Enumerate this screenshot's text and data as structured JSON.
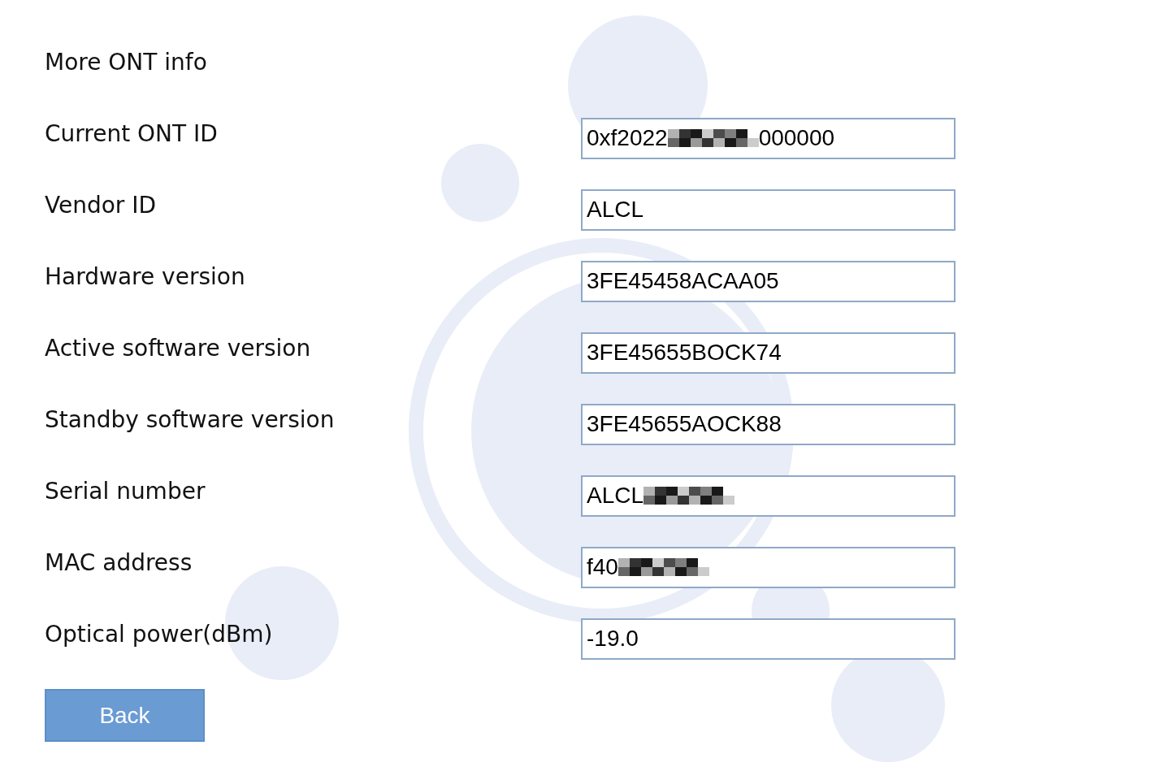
{
  "title": "More ONT info",
  "fields": [
    {
      "label": "Current ONT ID",
      "value": "0xf2022",
      "redacted": true,
      "value_end": "000000"
    },
    {
      "label": "Vendor ID",
      "value": "ALCL",
      "redacted": false
    },
    {
      "label": "Hardware version",
      "value": "3FE45458ACAA05",
      "redacted": false
    },
    {
      "label": "Active software version",
      "value": "3FE45655BOCK74",
      "redacted": false
    },
    {
      "label": "Standby software version",
      "value": "3FE45655AOCK88",
      "redacted": false
    },
    {
      "label": "Serial number",
      "value": "ALCL",
      "redacted": true
    },
    {
      "label": "MAC address",
      "value": "f40",
      "redacted": true
    },
    {
      "label": "Optical power(dBm)",
      "value": "-19.0",
      "redacted": false
    }
  ],
  "buttons": [
    "Back"
  ]
}
